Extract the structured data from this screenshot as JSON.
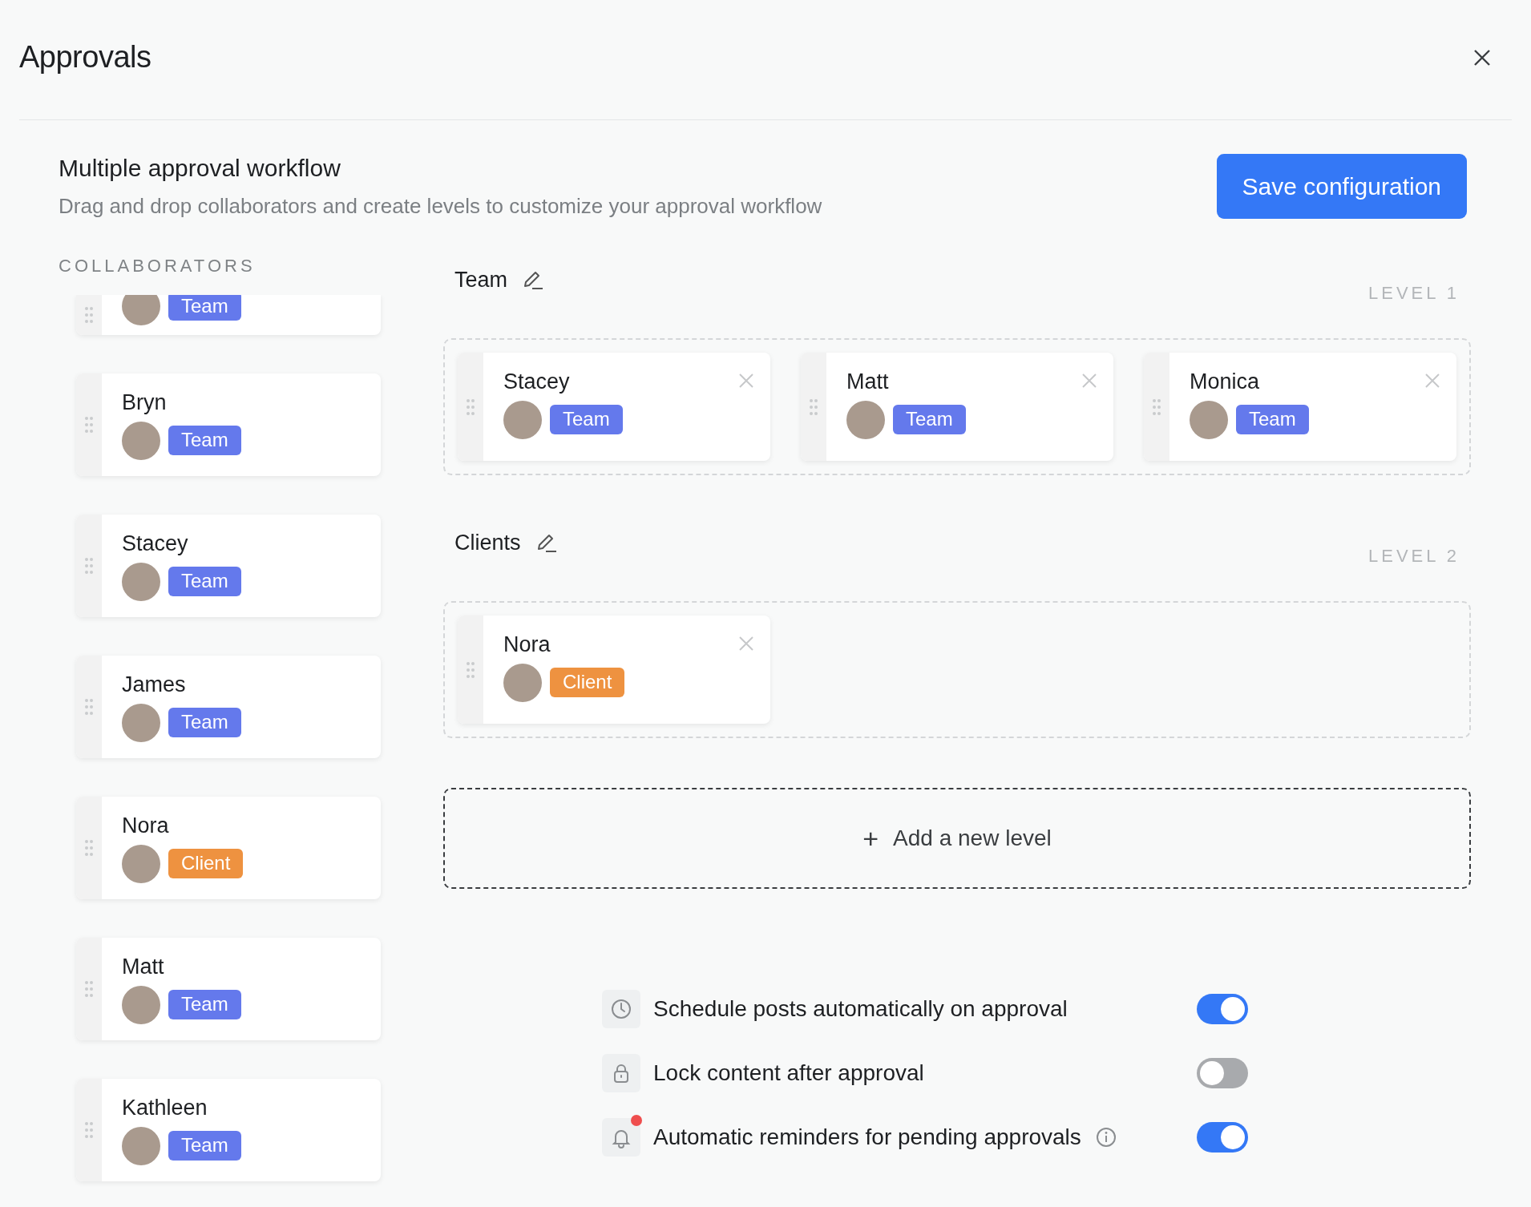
{
  "window": {
    "title": "Approvals"
  },
  "header": {
    "title": "Multiple approval workflow",
    "subtitle": "Drag and drop collaborators and create levels to customize your approval workflow",
    "save_button": "Save configuration"
  },
  "collaborators": {
    "heading": "COLLABORATORS",
    "items": [
      {
        "badge": "Team",
        "kind": "team"
      },
      {
        "name": "Bryn",
        "badge": "Team",
        "kind": "team"
      },
      {
        "name": "Stacey",
        "badge": "Team",
        "kind": "team"
      },
      {
        "name": "James",
        "badge": "Team",
        "kind": "team"
      },
      {
        "name": "Nora",
        "badge": "Client",
        "kind": "client"
      },
      {
        "name": "Matt",
        "badge": "Team",
        "kind": "team"
      },
      {
        "name": "Kathleen",
        "badge": "Team",
        "kind": "team"
      }
    ]
  },
  "levels": [
    {
      "name": "Team",
      "level_label": "LEVEL 1",
      "members": [
        {
          "name": "Stacey",
          "badge": "Team",
          "kind": "team"
        },
        {
          "name": "Matt",
          "badge": "Team",
          "kind": "team"
        },
        {
          "name": "Monica",
          "badge": "Team",
          "kind": "team"
        }
      ]
    },
    {
      "name": "Clients",
      "level_label": "LEVEL 2",
      "members": [
        {
          "name": "Nora",
          "badge": "Client",
          "kind": "client"
        }
      ]
    }
  ],
  "add_level": {
    "icon": "+",
    "label": "Add a new level"
  },
  "settings": [
    {
      "kind": "clock",
      "label": "Schedule posts automatically on approval",
      "on": true
    },
    {
      "kind": "lock",
      "label": "Lock content after approval",
      "on": false
    },
    {
      "kind": "bell",
      "label": "Automatic reminders for pending approvals",
      "on": true,
      "info": true
    }
  ]
}
